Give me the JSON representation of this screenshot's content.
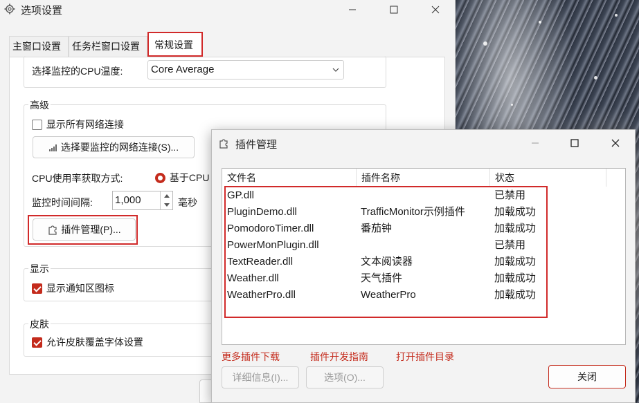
{
  "main_window": {
    "title": "选项设置",
    "icon": "gear-icon",
    "tabs": [
      "主窗口设置",
      "任务栏窗口设置",
      "常规设置"
    ],
    "active_tab": "常规设置",
    "cpu_temp": {
      "label": "选择监控的CPU温度:",
      "value": "Core Average"
    },
    "advanced": {
      "title": "高级",
      "show_all_net_label": "显示所有网络连接",
      "show_all_net_checked": false,
      "select_net_button": "选择要监控的网络连接(S)...",
      "cpu_usage_label": "CPU使用率获取方式:",
      "cpu_usage_option": "基于CPU",
      "interval_label": "监控时间间隔:",
      "interval_value": "1,000",
      "interval_unit": "毫秒",
      "plugin_button": "插件管理(P)..."
    },
    "display": {
      "title": "显示",
      "notify_icon_label": "显示通知区图标",
      "notify_icon_checked": true
    },
    "skin": {
      "title": "皮肤",
      "skin_font_label": "允许皮肤覆盖字体设置",
      "skin_font_checked": true
    }
  },
  "plugin_dialog": {
    "title": "插件管理",
    "icon": "puzzle-icon",
    "columns": [
      "文件名",
      "插件名称",
      "状态"
    ],
    "rows": [
      {
        "file": "GP.dll",
        "name": "",
        "status": "已禁用"
      },
      {
        "file": "PluginDemo.dll",
        "name": "TrafficMonitor示例插件",
        "status": "加载成功"
      },
      {
        "file": "PomodoroTimer.dll",
        "name": "番茄钟",
        "status": "加载成功"
      },
      {
        "file": "PowerMonPlugin.dll",
        "name": "",
        "status": "已禁用"
      },
      {
        "file": "TextReader.dll",
        "name": "文本阅读器",
        "status": "加载成功"
      },
      {
        "file": "Weather.dll",
        "name": "天气插件",
        "status": "加载成功"
      },
      {
        "file": "WeatherPro.dll",
        "name": "WeatherPro",
        "status": "加载成功"
      }
    ],
    "links": [
      "更多插件下载",
      "插件开发指南",
      "打开插件目录"
    ],
    "details_button": "详细信息(I)...",
    "options_button": "选项(O)...",
    "close_button": "关闭"
  },
  "colors": {
    "accent": "#c42b1c",
    "highlight": "#d12a2a",
    "link": "#c42b1c"
  }
}
